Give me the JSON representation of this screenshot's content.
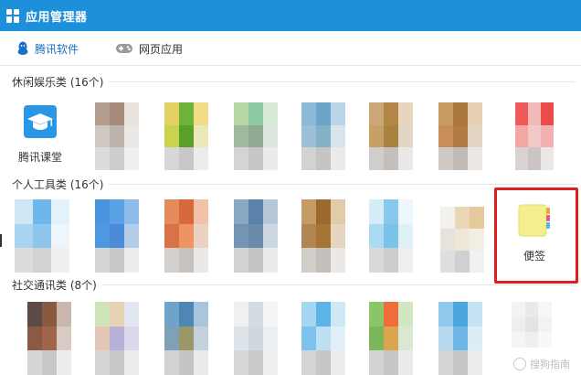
{
  "window": {
    "title": "应用管理器",
    "icon": "grid-icon"
  },
  "tabs": [
    {
      "label": "腾讯软件",
      "icon": "penguin-icon",
      "active": true
    },
    {
      "label": "网页应用",
      "icon": "gamepad-icon",
      "active": false
    }
  ],
  "categories": [
    {
      "label": "休闲娱乐类 (16个)"
    },
    {
      "label": "个人工具类 (16个)"
    },
    {
      "label": "社交通讯类 (8个)"
    }
  ],
  "apps": {
    "tencent_classroom": {
      "name": "腾讯课堂",
      "icon": "graduation-cap-icon"
    },
    "sticky_notes": {
      "name": "便签",
      "icon": "sticky-note-icon"
    }
  },
  "colors": {
    "accent": "#1e8fdb",
    "highlight": "#e02020"
  },
  "watermark": {
    "text": "搜狗指南"
  }
}
